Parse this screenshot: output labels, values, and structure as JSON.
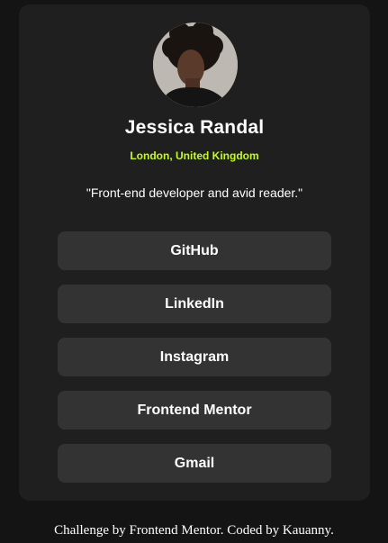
{
  "profile": {
    "avatar_icon": "profile-photo",
    "name": "Jessica Randal",
    "location": "London, United Kingdom",
    "bio": "\"Front-end developer and avid reader.\""
  },
  "links": [
    {
      "label": "GitHub"
    },
    {
      "label": "LinkedIn"
    },
    {
      "label": "Instagram"
    },
    {
      "label": "Frontend Mentor"
    },
    {
      "label": "Gmail"
    }
  ],
  "footer": {
    "text": "Challenge by Frontend Mentor. Coded by Kauanny."
  },
  "colors": {
    "background": "#141414",
    "card": "#1f1f1f",
    "button": "#333333",
    "accent": "#c4f82a",
    "text": "#ffffff"
  }
}
